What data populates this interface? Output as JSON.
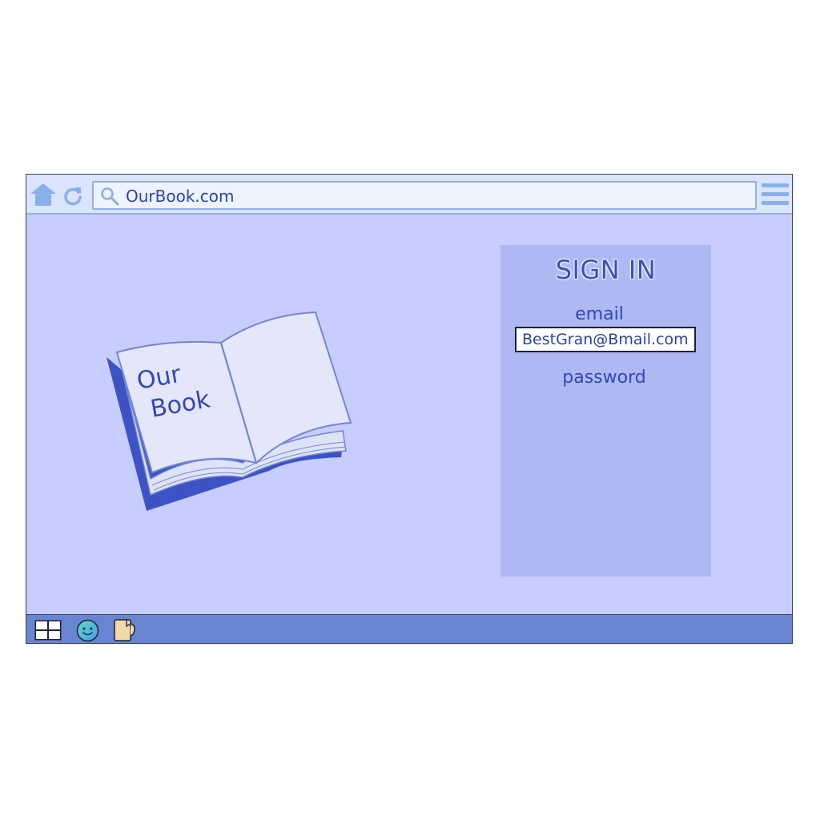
{
  "browser": {
    "url": "OurBook.com",
    "icons": {
      "home": "home-icon",
      "reload": "reload-icon",
      "search": "search-icon",
      "menu": "menu-icon"
    }
  },
  "hero": {
    "book_cover_text_line1": "Our",
    "book_cover_text_line2": "Book"
  },
  "signin": {
    "title": "SIGN IN",
    "email_label": "email",
    "email_value": "BestGran@Bmail.com",
    "password_label": "password"
  },
  "taskbar": {
    "icons": [
      "start-icon",
      "smiley-icon",
      "files-icon"
    ]
  },
  "colors": {
    "page_background": "#c7cdfc",
    "panel_background": "#aeb8f2",
    "accent": "#3a4fc0",
    "taskbar": "#6885d1",
    "toolbar": "#dbe4fd"
  }
}
